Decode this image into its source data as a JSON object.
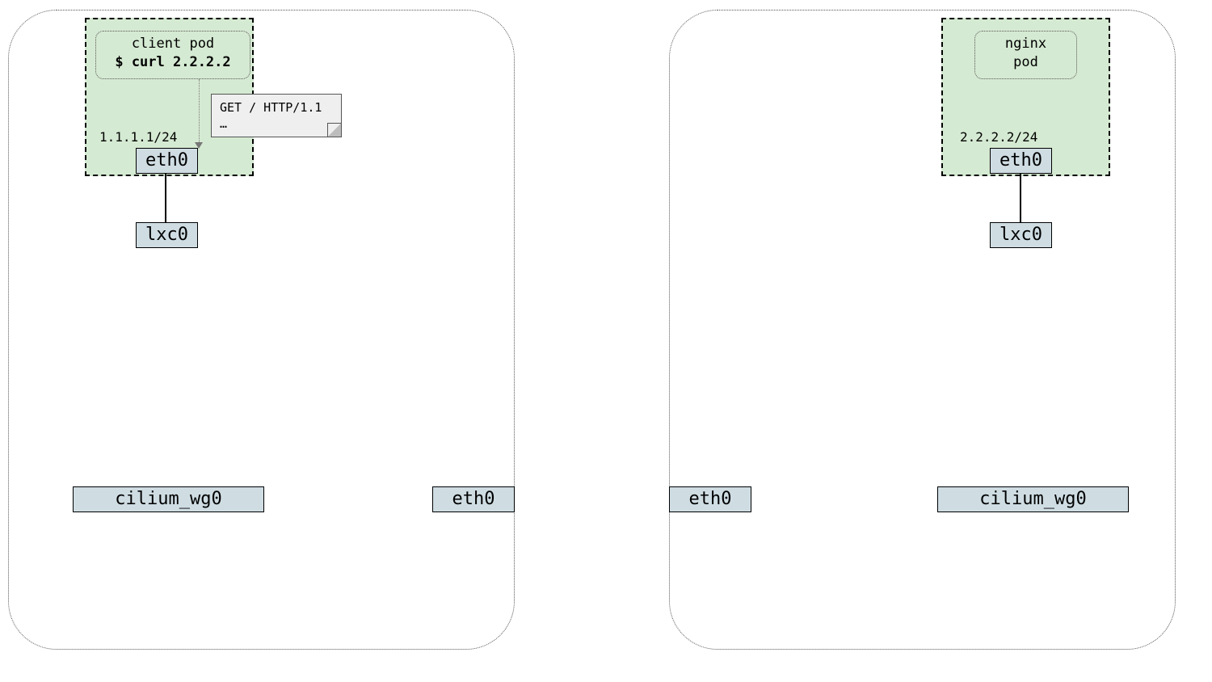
{
  "left": {
    "pod": {
      "title_line1": "client pod",
      "title_line2": "$ curl 2.2.2.2",
      "ip": "1.1.1.1/24",
      "eth": "eth0",
      "note_line1": "GET / HTTP/1.1",
      "note_line2": "…"
    },
    "lxc": "lxc0",
    "wg": "cilium_wg0",
    "host_eth": "eth0"
  },
  "right": {
    "pod": {
      "title_line1": "nginx",
      "title_line2": "pod",
      "ip": "2.2.2.2/24",
      "eth": "eth0"
    },
    "lxc": "lxc0",
    "wg": "cilium_wg0",
    "host_eth": "eth0"
  }
}
